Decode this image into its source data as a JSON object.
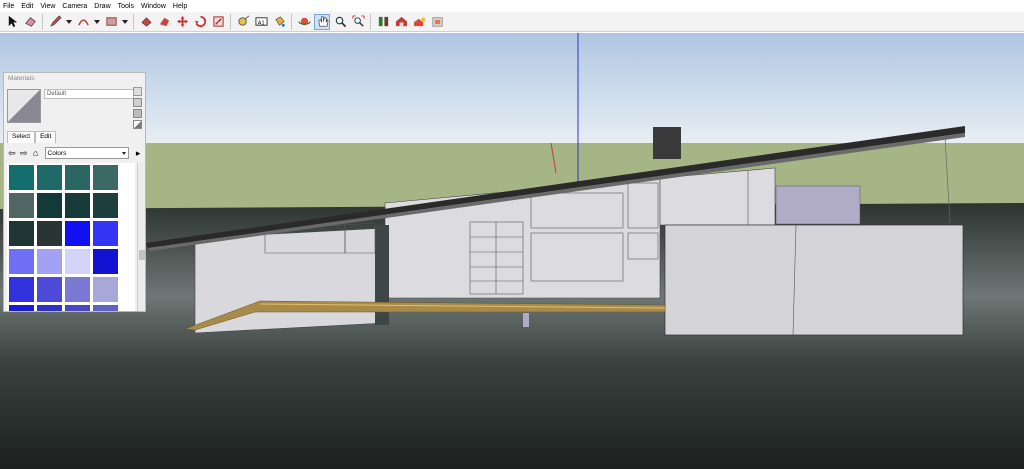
{
  "menu": [
    "File",
    "Edit",
    "View",
    "Camera",
    "Draw",
    "Tools",
    "Window",
    "Help"
  ],
  "toolbar": {
    "tools": [
      {
        "name": "select-icon"
      },
      {
        "name": "eraser-icon"
      },
      {
        "name": "pencil-icon",
        "caret": true
      },
      {
        "name": "arc-icon",
        "caret": true
      },
      {
        "name": "rectangle-icon",
        "caret": true
      },
      {
        "name": "push-pull-icon"
      },
      {
        "name": "follow-me-icon"
      },
      {
        "name": "move-icon"
      },
      {
        "name": "rotate-icon"
      },
      {
        "name": "scale-icon"
      },
      {
        "name": "tape-measure-icon"
      },
      {
        "name": "text-icon"
      },
      {
        "name": "paint-bucket-icon"
      },
      {
        "name": "orbit-icon"
      },
      {
        "name": "pan-icon",
        "active": true
      },
      {
        "name": "zoom-icon"
      },
      {
        "name": "zoom-extents-icon"
      },
      {
        "name": "components-icon"
      },
      {
        "name": "warehouse-icon"
      },
      {
        "name": "share-model-icon"
      },
      {
        "name": "extension-icon"
      }
    ]
  },
  "materials": {
    "title": "Materials",
    "current_name": "Default",
    "tabs": [
      "Select",
      "Edit"
    ],
    "collection": "Colors",
    "swatches": [
      "#156e6e",
      "#1f6a69",
      "#2b6662",
      "#3b6a66",
      "#4f6664",
      "#123a3a",
      "#163c3a",
      "#1d3e3c",
      "#1f3533",
      "#2a3533",
      "#1010f0",
      "#3535f5",
      "#6f6ff5",
      "#a2a2f5",
      "#d3d3f7",
      "#1212d2",
      "#3333dd",
      "#4b4bd8",
      "#7a7ad5",
      "#a8a8d8",
      "#1a1ad0",
      "#3131c8",
      "#4747c4",
      "#6060c0"
    ]
  },
  "colors": {
    "sky_top": "#aec6e2",
    "horizon": "#e7ecf0",
    "ground": "#a6b586",
    "terrain": "#333a36",
    "wall": "#d9d8dc",
    "roof": "#2a2a2a",
    "deck": "#a88b4a",
    "axis_blue": "#2a36c6",
    "axis_red": "#d13a2a"
  }
}
